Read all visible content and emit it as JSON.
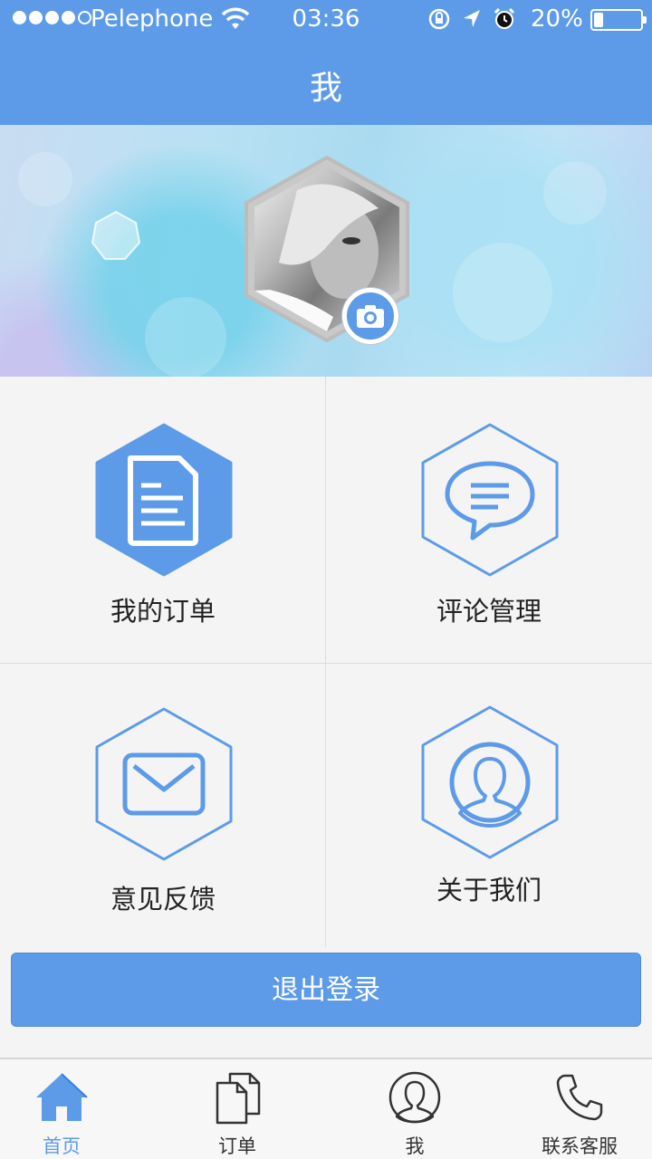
{
  "status_bar": {
    "carrier": "Pelephone",
    "time": "03:36",
    "battery": "20%",
    "battery_level": 0.2,
    "signal_bars": 4,
    "icons": [
      "wifi-icon",
      "orientation-lock-icon",
      "location-icon",
      "alarm-icon"
    ]
  },
  "header": {
    "title": "我"
  },
  "profile": {
    "avatar": "avatar-icon",
    "camera": "camera-icon"
  },
  "menu": [
    {
      "label": "我的订单",
      "icon": "document-icon"
    },
    {
      "label": "评论管理",
      "icon": "comment-icon"
    },
    {
      "label": "意见反馈",
      "icon": "mail-icon"
    },
    {
      "label": "关于我们",
      "icon": "user-icon"
    }
  ],
  "logout_label": "退出登录",
  "tabs": [
    {
      "label": "首页",
      "icon": "home-icon",
      "active": true
    },
    {
      "label": "订单",
      "icon": "orders-icon",
      "active": false
    },
    {
      "label": "我",
      "icon": "profile-icon",
      "active": false
    },
    {
      "label": "联系客服",
      "icon": "phone-icon",
      "active": false
    }
  ],
  "colors": {
    "accent": "#5d9be9",
    "background": "#f4f4f4",
    "text": "#222222"
  }
}
